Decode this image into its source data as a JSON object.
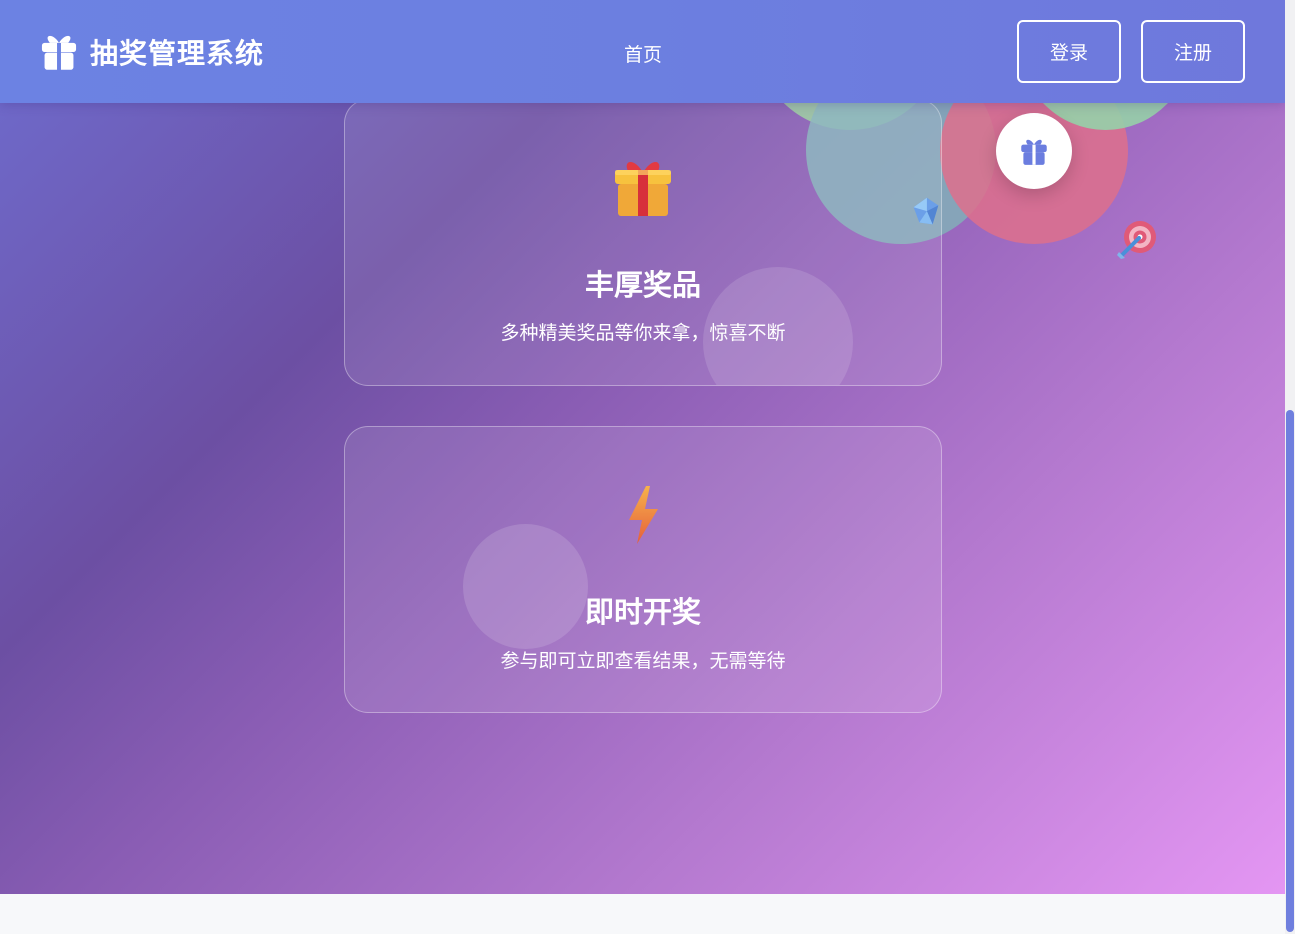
{
  "header": {
    "logo_text": "抽奖管理系统",
    "logo_icon": "gift-icon",
    "nav_home": "首页",
    "login_label": "登录",
    "register_label": "注册"
  },
  "decor": {
    "gift_badge_icon": "gift-icon",
    "floating_icons": [
      "gem-icon",
      "target-dart-icon"
    ]
  },
  "features": [
    {
      "icon": "gift-box-icon",
      "title": "丰厚奖品",
      "desc": "多种精美奖品等你来拿，惊喜不断"
    },
    {
      "icon": "lightning-icon",
      "title": "即时开奖",
      "desc": "参与即可立即查看结果，无需等待"
    }
  ],
  "colors": {
    "header": "#6c7fe0",
    "accent": "#6f7fde",
    "gradient_start": "#6f6dcf",
    "gradient_end": "#e496f3"
  }
}
